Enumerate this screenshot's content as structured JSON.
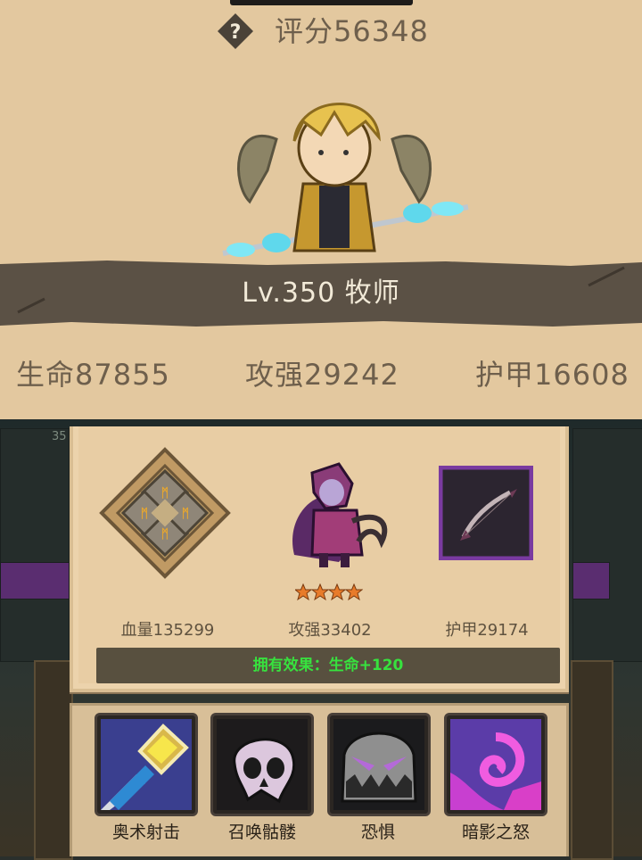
{
  "header": {
    "help_symbol": "?",
    "score_text": "评分56348"
  },
  "hero": {
    "level_text": "Lv.350 牧师",
    "stats": [
      {
        "text": "生命87855"
      },
      {
        "text": "攻强29242"
      },
      {
        "text": "护甲16608"
      }
    ]
  },
  "scene": {
    "level_tag": "35"
  },
  "equipment": {
    "items": [
      {
        "icon": "rune-cross-icon",
        "label": "血量135299"
      },
      {
        "icon": "dark-ranger-icon",
        "label": "攻强33402",
        "stars": 4
      },
      {
        "icon": "bow-icon",
        "label": "护甲29174"
      }
    ],
    "effect_text": "拥有效果：生命+120"
  },
  "skills": [
    {
      "icon": "arcane-staff-icon",
      "label": "奥术射击"
    },
    {
      "icon": "skull-icon",
      "label": "召唤骷髅"
    },
    {
      "icon": "fear-mask-icon",
      "label": "恐惧"
    },
    {
      "icon": "shadow-swirl-icon",
      "label": "暗影之怒"
    }
  ],
  "colors": {
    "parchment": "#e3c89f",
    "banner": "#5b5145",
    "effect_green": "#37e23e",
    "rarity_purple": "#7a3aa0"
  }
}
